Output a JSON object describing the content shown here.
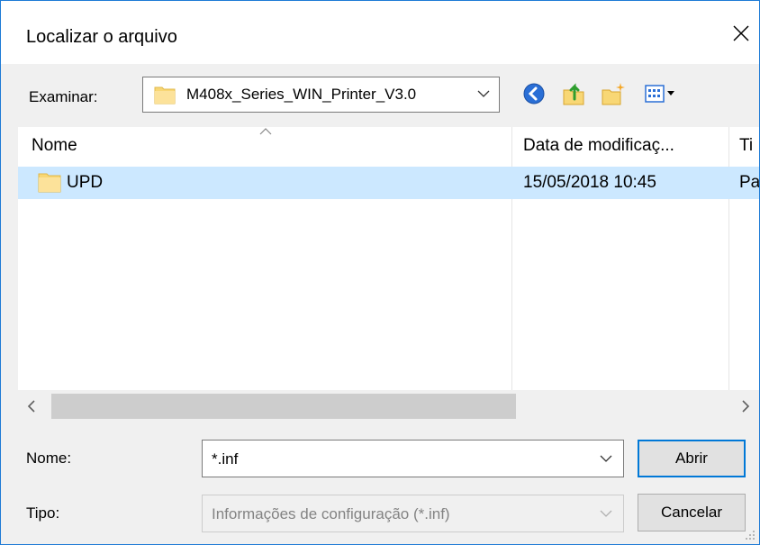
{
  "dialog": {
    "title": "Localizar o arquivo"
  },
  "lookin": {
    "label": "Examinar:",
    "value": "M408x_Series_WIN_Printer_V3.0",
    "icon": "folder-icon"
  },
  "toolbar": {
    "icons": [
      "back-icon",
      "up-folder-icon",
      "new-folder-icon",
      "view-menu-icon"
    ]
  },
  "list": {
    "columns": [
      "Nome",
      "Data de modificaç...",
      "Ti"
    ],
    "rows": [
      {
        "name": "UPD",
        "modified": "15/05/2018 10:45",
        "type": "Pa"
      }
    ]
  },
  "filename": {
    "label": "Nome:",
    "value": "*.inf"
  },
  "filetype": {
    "label": "Tipo:",
    "value": "Informações de configuração (*.inf)"
  },
  "buttons": {
    "open": "Abrir",
    "cancel": "Cancelar"
  },
  "colors": {
    "accent": "#0078d7",
    "selection": "#cce8ff",
    "window_border": "#1e7bd6"
  }
}
